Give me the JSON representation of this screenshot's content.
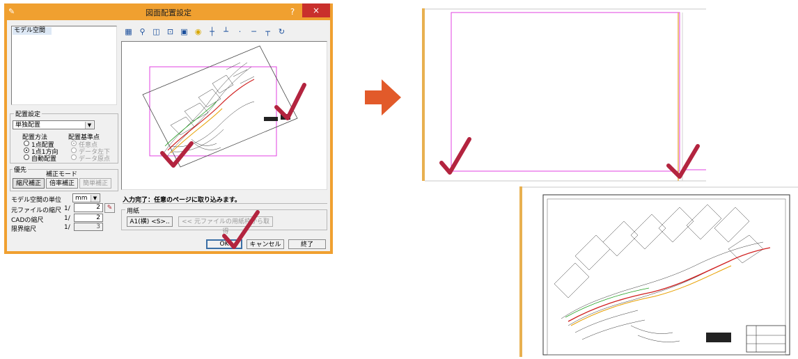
{
  "dialog": {
    "title": "図面配置設定",
    "help_label": "?",
    "close_label": "×",
    "model_space_item": "モデル空間",
    "layout_group": {
      "title": "配置設定",
      "mode_value": "単独配置",
      "method_label": "配置方法",
      "reference_label": "配置基準点",
      "methods": [
        "1点配置",
        "1点1方向",
        "自動配置"
      ],
      "references": [
        "任意点",
        "データ左下",
        "データ原点"
      ]
    },
    "priority_group": {
      "title": "優先",
      "correction_mode_label": "補正モード",
      "buttons": [
        "縮尺補正",
        "倍率補正",
        "簡単補正"
      ]
    },
    "unit_label": "モデル空間の単位",
    "unit_value": "mm",
    "source_scale_label": "元ファイルの縮尺",
    "source_scale_prefix": "1/",
    "source_scale_value": "2",
    "cad_scale_label": "CADの縮尺",
    "cad_scale_prefix": "1/",
    "cad_scale_value": "2",
    "limit_scale_label": "限界縮尺",
    "limit_scale_prefix": "1/",
    "limit_scale_value": "3",
    "status_message": "入力完了：任意のページに取り込みます。",
    "paper_group": {
      "title": "用紙",
      "paper_button": "A1(横) <S>..",
      "get_from_source_button": "<< 元ファイルの用紙枠から取得"
    },
    "ok_label": "OK",
    "cancel_label": "キャンセル",
    "exit_label": "終了"
  },
  "toolbar_icons": [
    "layer-icon",
    "zoom-icon",
    "zoom-window-icon",
    "fit-icon",
    "select-icon",
    "bulb-icon",
    "point-icon",
    "line-h-icon",
    "point-dot-icon",
    "line-icon",
    "line-under-icon",
    "rotate-icon"
  ],
  "colors": {
    "title_bar": "#f0a030",
    "close_button": "#c9302c",
    "arrow": "#e25a2a",
    "check_mark": "#b3243f",
    "frame_magenta": "#e040e0"
  }
}
